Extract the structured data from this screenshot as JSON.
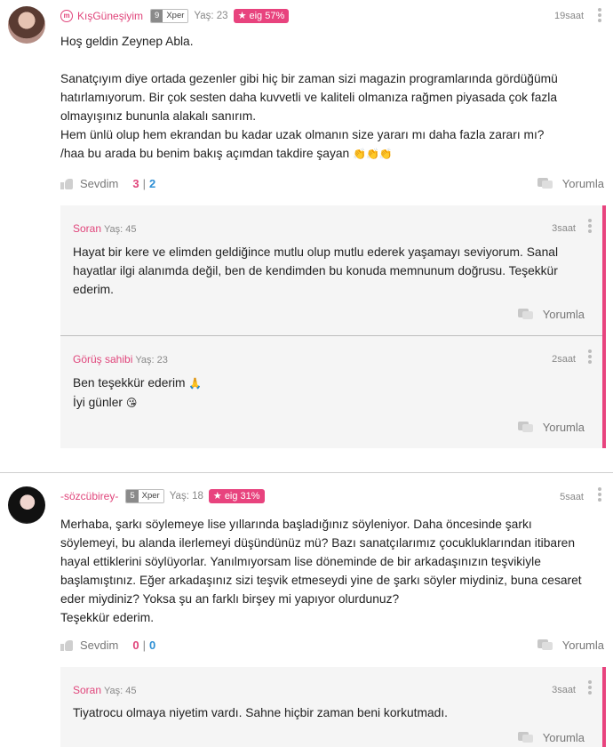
{
  "post1": {
    "username": "KışGüneşiyim",
    "level": "9",
    "level_label": "Xper",
    "age": "Yaş: 23",
    "eig": "eig 57%",
    "time": "19saat",
    "greeting": "Hoş geldin Zeynep Abla.",
    "line1": "Sanatçıyım diye ortada gezenler gibi hiç bir zaman sizi magazin programlarında gördüğümü",
    "line2": "hatırlamıyorum. Bir çok sesten daha kuvvetli ve kaliteli olmanıza rağmen piyasada çok fazla",
    "line3": "olmayışınız bununla alakalı sanırım.",
    "line4": "Hem ünlü olup hem ekrandan bu kadar uzak olmanın size yararı mı daha fazla zararı mı?",
    "line5": "/haa bu arada bu benim bakış açımdan takdire şayan",
    "clap": "👏👏👏",
    "like_label": "Sevdim",
    "likes": "3",
    "sep": "|",
    "dislikes": "2",
    "reply_label": "Yorumla",
    "replies": [
      {
        "name": "Soran",
        "age": "Yaş: 45",
        "time": "3saat",
        "lines": [
          "Hayat bir kere ve elimden geldiğince mutlu olup mutlu ederek yaşamayı seviyorum. Sanal",
          "hayatlar ilgi alanımda değil, ben de kendimden bu konuda memnunum doğrusu. Teşekkür",
          "ederim."
        ],
        "reply_label": "Yorumla"
      },
      {
        "name": "Görüş sahibi",
        "age": "Yaş: 23",
        "time": "2saat",
        "line1": "Ben teşekkür ederim",
        "emoji1": "🙏",
        "line2": "İyi günler",
        "emoji2": "😘",
        "reply_label": "Yorumla"
      }
    ]
  },
  "post2": {
    "username": "-sözcübirey-",
    "level": "5",
    "level_label": "Xper",
    "age": "Yaş: 18",
    "eig": "eig 31%",
    "time": "5saat",
    "lines": [
      "Merhaba, şarkı söylemeye lise yıllarında başladığınız söyleniyor. Daha öncesinde şarkı",
      "söylemeyi, bu alanda ilerlemeyi düşündünüz mü? Bazı sanatçılarımız çocukluklarından itibaren",
      "hayal ettiklerini söylüyorlar. Yanılmıyorsam lise döneminde de bir arkadaşınızın teşvikiyle",
      "başlamıştınız. Eğer arkadaşınız sizi teşvik etmeseydi yine de şarkı söyler miydiniz, buna cesaret",
      "eder miydiniz? Yoksa şu an farklı birşey mi yapıyor olurdunuz?",
      "Teşekkür ederim."
    ],
    "like_label": "Sevdim",
    "likes": "0",
    "sep": "|",
    "dislikes": "0",
    "reply_label": "Yorumla",
    "reply": {
      "name": "Soran",
      "age": "Yaş: 45",
      "time": "3saat",
      "line": "Tiyatrocu olmaya niyetim vardı. Sahne hiçbir zaman beni korkutmadı.",
      "reply_label": "Yorumla"
    }
  }
}
